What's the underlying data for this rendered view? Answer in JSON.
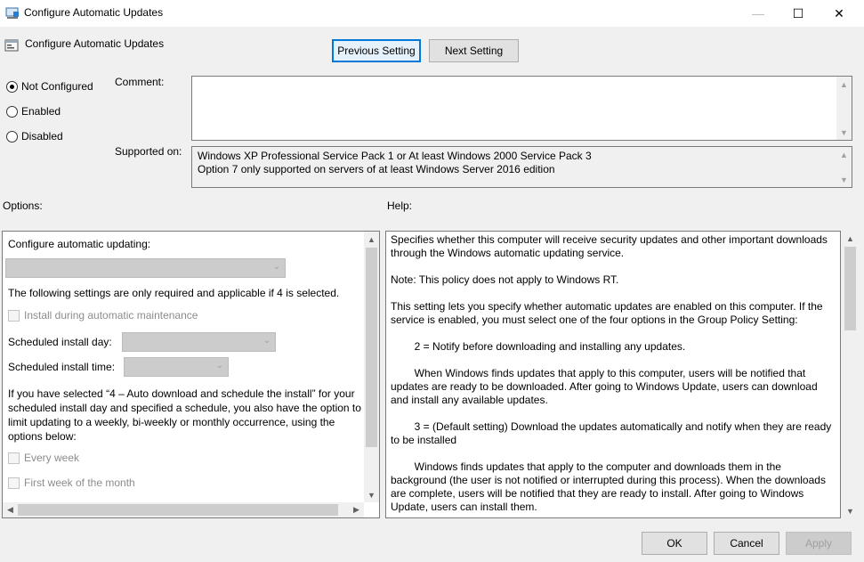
{
  "window": {
    "title": "Configure Automatic Updates",
    "min_glyph": "—",
    "max_glyph": "☐",
    "close_glyph": "✕"
  },
  "header": {
    "setting_title": "Configure Automatic Updates",
    "previous_label": "Previous Setting",
    "next_label": "Next Setting"
  },
  "state": {
    "options": [
      {
        "label": "Not Configured",
        "checked": true
      },
      {
        "label": "Enabled",
        "checked": false
      },
      {
        "label": "Disabled",
        "checked": false
      }
    ]
  },
  "comment": {
    "label": "Comment:",
    "value": ""
  },
  "supported": {
    "label": "Supported on:",
    "line1": "Windows XP Professional Service Pack 1 or At least Windows 2000 Service Pack 3",
    "line2": "Option 7 only supported on servers of at least Windows Server 2016 edition"
  },
  "options_panel": {
    "label": "Options:",
    "configure_label": "Configure automatic updating:",
    "configure_value": "",
    "note": "The following settings are only required and applicable if 4 is selected.",
    "maintenance_label": "Install during automatic maintenance",
    "install_day_label": "Scheduled install day:",
    "install_day_value": "",
    "install_time_label": "Scheduled install time:",
    "install_time_value": "",
    "schedule_note_1": "If you have selected “4 – Auto download and schedule the install” for your",
    "schedule_note_2": "scheduled install day and specified a schedule, you also have the option to",
    "schedule_note_3": "limit updating to a weekly, bi-weekly or monthly occurrence, using the",
    "schedule_note_4": "options below:",
    "every_week_label": "Every week",
    "first_week_label": "First week of the month"
  },
  "help_panel": {
    "label": "Help:",
    "paragraphs": [
      "Specifies whether this computer will receive security updates and other important downloads through the Windows automatic updating service.",
      "Note: This policy does not apply to Windows RT.",
      "This setting lets you specify whether automatic updates are enabled on this computer. If the service is enabled, you must select one of the four options in the Group Policy Setting:",
      "        2 = Notify before downloading and installing any updates.",
      "        When Windows finds updates that apply to this computer, users will be notified that updates are ready to be downloaded. After going to Windows Update, users can download and install any available updates.",
      "        3 = (Default setting) Download the updates automatically and notify when they are ready to be installed",
      "        Windows finds updates that apply to the computer and downloads them in the background (the user is not notified or interrupted during this process). When the downloads are complete, users will be notified that they are ready to install. After going to Windows Update, users can install them."
    ]
  },
  "footer": {
    "ok_label": "OK",
    "cancel_label": "Cancel",
    "apply_label": "Apply"
  }
}
